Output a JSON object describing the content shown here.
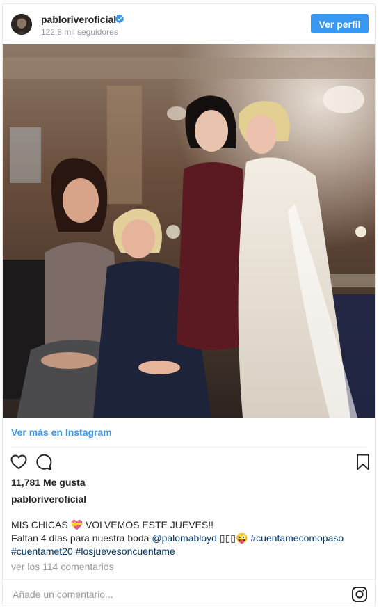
{
  "header": {
    "username": "pabloriveroficial",
    "followers": "122.8 mil seguidores",
    "profile_button": "Ver perfil",
    "avatar_icon": "avatar-image",
    "verified_icon": "verified-badge-icon",
    "accent_color": "#3897f0"
  },
  "post": {
    "see_more": "Ver más en Instagram",
    "likes": "11,781 Me gusta",
    "author": "pabloriveroficial",
    "caption_line1": "MIS CHICAS 💝 VOLVEMOS ESTE JUEVES!!",
    "caption_line2_text": "Faltan 4 días para nuestra boda ",
    "mention": "@palomabloyd",
    "caption_line2_emojis": " ▯▯▯😜 ",
    "hashtag1": "#cuentamecomopaso",
    "hashtag2": "#cuentamet20",
    "hashtag3": "#losjuevesoncuentame",
    "comments_link": "ver los 114 comentarios",
    "comment_placeholder": "Añade un comentario...",
    "icons": [
      "heart-icon",
      "comment-icon",
      "bookmark-icon",
      "instagram-icon"
    ]
  }
}
